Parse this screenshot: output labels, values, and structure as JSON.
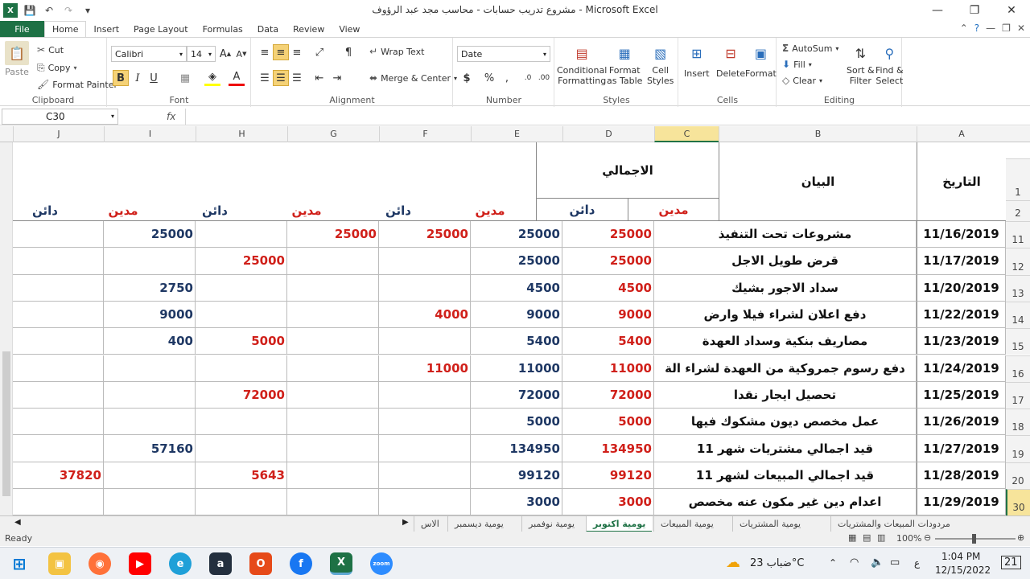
{
  "window": {
    "title": "مشروع تدريب حسابات - محاسب مجد عبد الرؤوف - Microsoft Excel"
  },
  "tabs": [
    "File",
    "Home",
    "Insert",
    "Page Layout",
    "Formulas",
    "Data",
    "Review",
    "View"
  ],
  "ribbon": {
    "clipboard": {
      "paste": "Paste",
      "cut": "Cut",
      "copy": "Copy",
      "format_painter": "Format Painter",
      "label": "Clipboard"
    },
    "font": {
      "name": "Calibri",
      "size": "14",
      "label": "Font"
    },
    "alignment": {
      "wrap": "Wrap Text",
      "merge": "Merge & Center",
      "label": "Alignment"
    },
    "number": {
      "format": "Date",
      "label": "Number"
    },
    "styles": {
      "conditional": "Conditional Formatting",
      "conditional_1": "Conditional",
      "conditional_2": "Formatting",
      "table_1": "Format",
      "table_2": "as Table",
      "cell_1": "Cell",
      "cell_2": "Styles",
      "label": "Styles"
    },
    "cells": {
      "insert": "Insert",
      "delete": "Delete",
      "format": "Format",
      "label": "Cells"
    },
    "editing": {
      "autosum": "AutoSum",
      "fill": "Fill",
      "clear": "Clear",
      "sort_1": "Sort &",
      "sort_2": "Filter",
      "find_1": "Find &",
      "find_2": "Select",
      "label": "Editing"
    }
  },
  "formula_bar": {
    "name_box": "C30",
    "fx": "fx"
  },
  "columns": [
    "J",
    "I",
    "H",
    "G",
    "F",
    "E",
    "D",
    "C",
    "B",
    "A"
  ],
  "header": {
    "date": "التاريخ",
    "desc": "البيان",
    "total": "الاجمالي",
    "debit": "مدين",
    "credit": "دائن"
  },
  "rows": [
    {
      "row": "11",
      "date": "11/16/2019",
      "desc": "مشروعات تحت التنفيذ",
      "C": "25000",
      "D": "25000",
      "E": "25000",
      "F": "25000",
      "G": "",
      "H": "",
      "I": "25000",
      "J": ""
    },
    {
      "row": "12",
      "date": "11/17/2019",
      "desc": "قرض طويل الاجل",
      "C": "25000",
      "D": "25000",
      "E": "",
      "F": "",
      "G": "25000",
      "H": "",
      "I": "",
      "J": ""
    },
    {
      "row": "13",
      "date": "11/20/2019",
      "desc": "سداد الاجور بشيك",
      "C": "4500",
      "D": "4500",
      "E": "",
      "F": "",
      "G": "",
      "H": "",
      "I": "2750",
      "J": ""
    },
    {
      "row": "14",
      "date": "11/22/2019",
      "desc": "دفع اعلان لشراء فيلا وارض",
      "C": "9000",
      "D": "9000",
      "E": "4000",
      "F": "",
      "G": "",
      "H": "",
      "I": "9000",
      "J": ""
    },
    {
      "row": "15",
      "date": "11/23/2019",
      "desc": "مصاريف بنكية وسداد العهدة",
      "C": "5400",
      "D": "5400",
      "E": "",
      "F": "",
      "G": "5000",
      "H": "",
      "I": "400",
      "J": ""
    },
    {
      "row": "16",
      "date": "11/24/2019",
      "desc": "دفع رسوم جمروكية من العهدة لشراء الة",
      "C": "11000",
      "D": "11000",
      "E": "11000",
      "F": "",
      "G": "",
      "H": "",
      "I": "",
      "J": ""
    },
    {
      "row": "17",
      "date": "11/25/2019",
      "desc": "تحصيل ايجار نقدا",
      "C": "72000",
      "D": "72000",
      "E": "",
      "F": "",
      "G": "72000",
      "H": "",
      "I": "",
      "J": ""
    },
    {
      "row": "18",
      "date": "11/26/2019",
      "desc": "عمل مخصص ديون مشكوك فيها",
      "C": "5000",
      "D": "5000",
      "E": "",
      "F": "",
      "G": "",
      "H": "",
      "I": "",
      "J": ""
    },
    {
      "row": "19",
      "date": "11/27/2019",
      "desc": "قيد اجمالي مشتريات شهر 11",
      "C": "134950",
      "D": "134950",
      "E": "",
      "F": "",
      "G": "",
      "H": "",
      "I": "57160",
      "J": ""
    },
    {
      "row": "20",
      "date": "11/28/2019",
      "desc": "قيد اجمالي المبيعات لشهر 11",
      "C": "99120",
      "D": "99120",
      "E": "",
      "F": "",
      "G": "5643",
      "H": "",
      "I": "",
      "J": "37820"
    },
    {
      "row": "30",
      "date": "11/29/2019",
      "desc": "اعدام دين غير مكون عنه مخصص",
      "C": "3000",
      "D": "3000",
      "E": "",
      "F": "",
      "G": "",
      "H": "",
      "I": "",
      "J": ""
    }
  ],
  "sheet_tabs": [
    "مردودات المبيعات والمشتريات",
    "يومية المشتريات",
    "يومية المبيعات",
    "يومية اكتوبر",
    "يومية نوفمبر",
    "يومية ديسمبر",
    "الاس"
  ],
  "active_sheet": "يومية اكتوبر",
  "status": {
    "ready": "Ready",
    "zoom": "100%"
  },
  "taskbar": {
    "weather": "ضباب 23°C",
    "time": "1:04 PM",
    "date": "12/15/2022",
    "notifications": "21",
    "lang": "ع"
  },
  "colors": {
    "excel_green": "#1e7145",
    "debit_red": "#d0201a",
    "credit_navy": "#1f3864",
    "selection": "#f7e49b"
  }
}
